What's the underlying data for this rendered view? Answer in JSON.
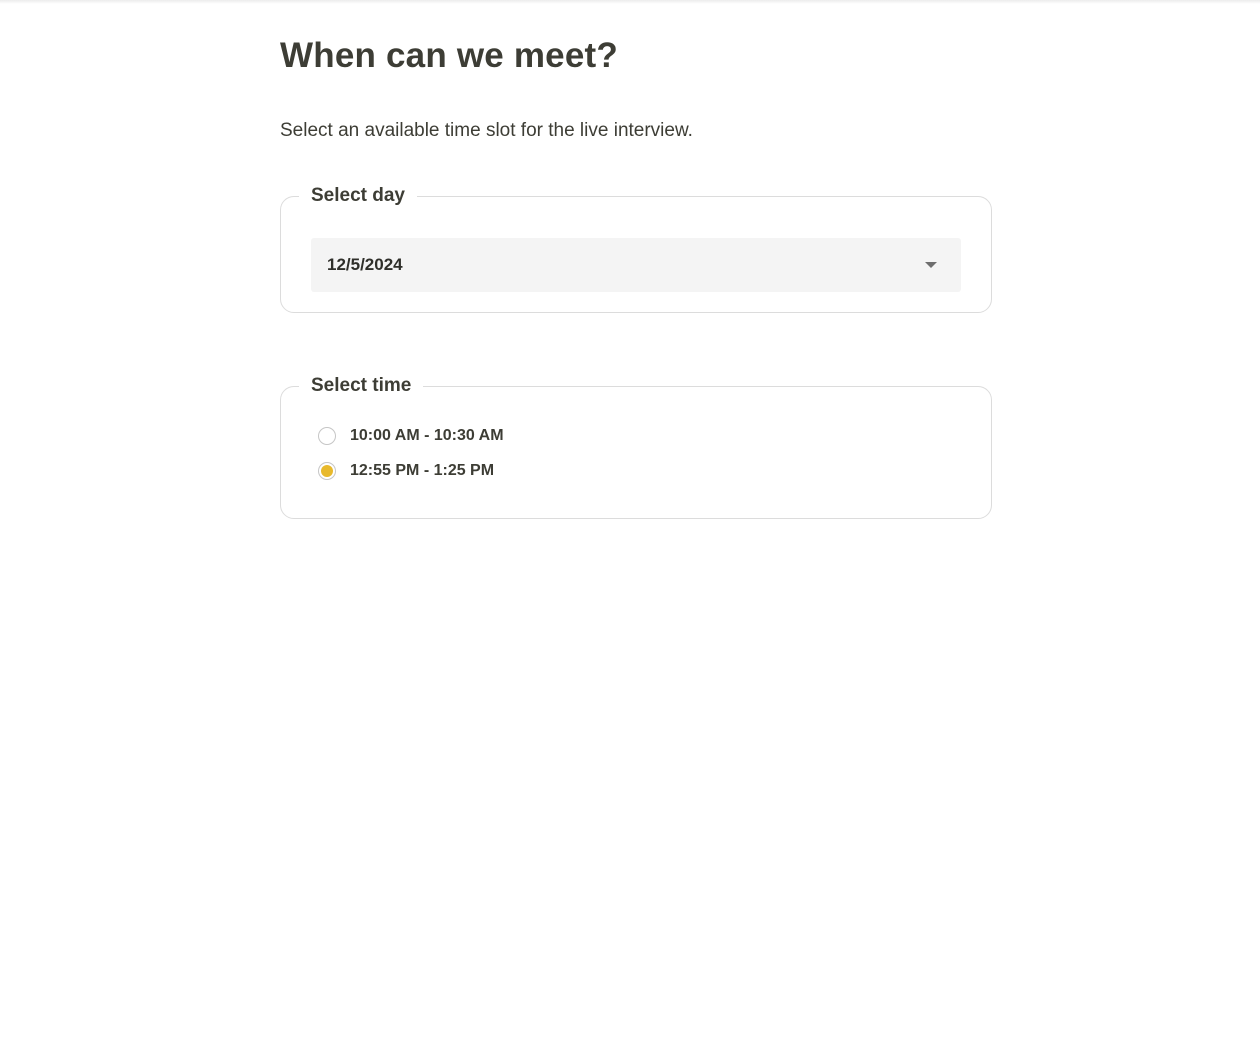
{
  "page": {
    "title": "When can we meet?",
    "subtitle": "Select an available time slot for the live interview."
  },
  "day_select": {
    "legend": "Select day",
    "selected_value": "12/5/2024",
    "icon": "chevron-down-icon"
  },
  "time_select": {
    "legend": "Select time",
    "options": [
      {
        "label": "10:00 AM - 10:30 AM",
        "checked": false
      },
      {
        "label": "12:55 PM - 1:25 PM",
        "checked": true
      }
    ]
  },
  "colors": {
    "accent": "#e8b92c",
    "text": "#3d3d35",
    "border": "#dcdcdc",
    "select_bg": "#f4f4f4"
  }
}
